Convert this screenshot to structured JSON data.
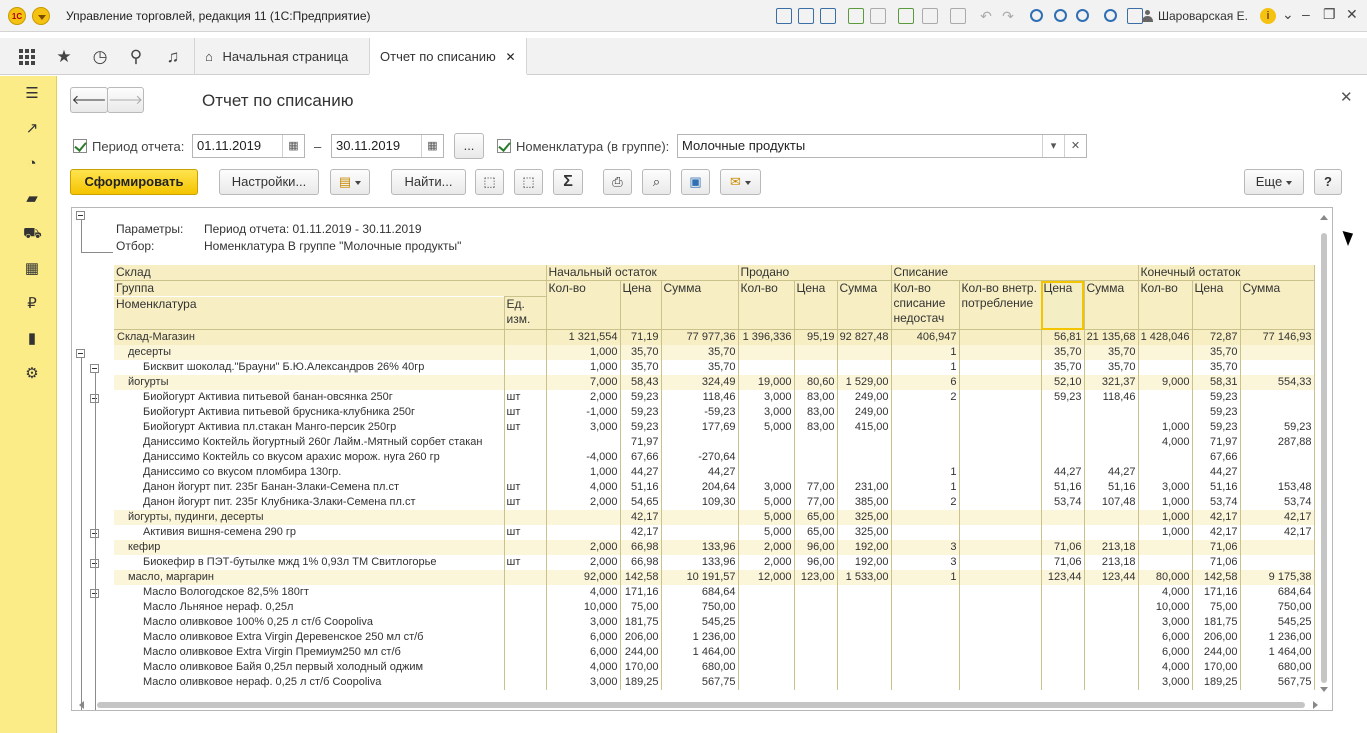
{
  "window": {
    "app_title": "Управление торговлей, редакция 11  (1С:Предприятие)",
    "user": "Шароварская Е.",
    "logo_text": "1С"
  },
  "sections": {
    "tabs": [
      {
        "label": "Начальная страница"
      },
      {
        "label": "Отчет по списанию"
      }
    ]
  },
  "form": {
    "title": "Отчет по списанию",
    "period_label": "Период отчета:",
    "period_from": "01.11.2019",
    "period_dash": "–",
    "period_to": "30.11.2019",
    "more_btn": "...",
    "nomen_label": "Номенклатура (в группе):",
    "nomen_value": "Молочные продукты",
    "generate_btn": "Сформировать",
    "settings_btn": "Настройки...",
    "find_btn": "Найти...",
    "more_menu_btn": "Еще",
    "help_btn": "?",
    "sigma_btn": "Σ"
  },
  "report": {
    "params_label": "Параметры:",
    "params_value": "Период отчета: 01.11.2019 - 30.11.2019",
    "filter_label": "Отбор:",
    "filter_value": "Номенклатура В группе \"Молочные продукты\"",
    "head": {
      "sklad": "Склад",
      "gruppa": "Группа",
      "nomen": "Номенклатура",
      "ed": "Ед. изм.",
      "start": "Начальный остаток",
      "sold": "Продано",
      "writeoff": "Списание",
      "end": "Конечный остаток",
      "qty": "Кол-во",
      "price": "Цена",
      "sum": "Сумма",
      "qty_short": "Кол-во списание недостач",
      "qty_internal": "Кол-во внетр. потребление"
    },
    "rows": [
      {
        "lvl": 0,
        "name": "Склад-Магазин",
        "ed": "",
        "v": [
          "1 321,554",
          "71,19",
          "77 977,36",
          "1 396,336",
          "95,19",
          "92 827,48",
          "406,947",
          "",
          "56,81",
          "21 135,68",
          "1 428,046",
          "72,87",
          "77 146,93"
        ]
      },
      {
        "lvl": 1,
        "name": "десерты",
        "ed": "",
        "v": [
          "1,000",
          "35,70",
          "35,70",
          "",
          "",
          "",
          "1",
          "",
          "35,70",
          "35,70",
          "",
          "35,70",
          ""
        ]
      },
      {
        "lvl": 2,
        "name": "Бисквит шоколад.\"Брауни\" Б.Ю.Александров  26% 40гр",
        "ed": "",
        "v": [
          "1,000",
          "35,70",
          "35,70",
          "",
          "",
          "",
          "1",
          "",
          "35,70",
          "35,70",
          "",
          "35,70",
          ""
        ]
      },
      {
        "lvl": 1,
        "name": "йогурты",
        "ed": "",
        "v": [
          "7,000",
          "58,43",
          "324,49",
          "19,000",
          "80,60",
          "1 529,00",
          "6",
          "",
          "52,10",
          "321,37",
          "9,000",
          "58,31",
          "554,33"
        ]
      },
      {
        "lvl": 2,
        "name": "Биойогурт Активиа питьевой банан-овсянка 250г",
        "ed": "шт",
        "v": [
          "2,000",
          "59,23",
          "118,46",
          "3,000",
          "83,00",
          "249,00",
          "2",
          "",
          "59,23",
          "118,46",
          "",
          "59,23",
          ""
        ]
      },
      {
        "lvl": 2,
        "name": "Биойогурт Активиа питьевой брусника-клубника 250г",
        "ed": "шт",
        "v": [
          "-1,000",
          "59,23",
          "-59,23",
          "3,000",
          "83,00",
          "249,00",
          "",
          "",
          "",
          "",
          "",
          "59,23",
          ""
        ]
      },
      {
        "lvl": 2,
        "name": "Биойогурт Активиа пл.стакан Манго-персик 250гр",
        "ed": "шт",
        "v": [
          "3,000",
          "59,23",
          "177,69",
          "5,000",
          "83,00",
          "415,00",
          "",
          "",
          "",
          "",
          "1,000",
          "59,23",
          "59,23"
        ]
      },
      {
        "lvl": 2,
        "name": "Даниссимо Коктейль йогуртный 260г Лайм.-Мятный сорбет стакан",
        "ed": "",
        "v": [
          "",
          "71,97",
          "",
          "",
          "",
          "",
          "",
          "",
          "",
          "",
          "4,000",
          "71,97",
          "287,88"
        ]
      },
      {
        "lvl": 2,
        "name": "Даниссимо Коктейль со вкусом арахис морож. нуга  260 гр",
        "ed": "",
        "v": [
          "-4,000",
          "67,66",
          "-270,64",
          "",
          "",
          "",
          "",
          "",
          "",
          "",
          "",
          "67,66",
          ""
        ]
      },
      {
        "lvl": 2,
        "name": "Даниссимо со вкусом пломбира 130гр.",
        "ed": "",
        "v": [
          "1,000",
          "44,27",
          "44,27",
          "",
          "",
          "",
          "1",
          "",
          "44,27",
          "44,27",
          "",
          "44,27",
          ""
        ]
      },
      {
        "lvl": 2,
        "name": "Данон йогурт пит. 235г Банан-Злаки-Семена пл.ст",
        "ed": "шт",
        "v": [
          "4,000",
          "51,16",
          "204,64",
          "3,000",
          "77,00",
          "231,00",
          "1",
          "",
          "51,16",
          "51,16",
          "3,000",
          "51,16",
          "153,48"
        ]
      },
      {
        "lvl": 2,
        "name": "Данон йогурт пит. 235г Клубника-Злаки-Семена пл.ст",
        "ed": "шт",
        "v": [
          "2,000",
          "54,65",
          "109,30",
          "5,000",
          "77,00",
          "385,00",
          "2",
          "",
          "53,74",
          "107,48",
          "1,000",
          "53,74",
          "53,74"
        ]
      },
      {
        "lvl": 1,
        "name": "йогурты, пудинги, десерты",
        "ed": "",
        "v": [
          "",
          "42,17",
          "",
          "5,000",
          "65,00",
          "325,00",
          "",
          "",
          "",
          "",
          "1,000",
          "42,17",
          "42,17"
        ]
      },
      {
        "lvl": 2,
        "name": "Активия вишня-семена 290 гр",
        "ed": "шт",
        "v": [
          "",
          "42,17",
          "",
          "5,000",
          "65,00",
          "325,00",
          "",
          "",
          "",
          "",
          "1,000",
          "42,17",
          "42,17"
        ]
      },
      {
        "lvl": 1,
        "name": "кефир",
        "ed": "",
        "v": [
          "2,000",
          "66,98",
          "133,96",
          "2,000",
          "96,00",
          "192,00",
          "3",
          "",
          "71,06",
          "213,18",
          "",
          "71,06",
          ""
        ]
      },
      {
        "lvl": 2,
        "name": "Биокефир в ПЭТ-бутылке мжд 1% 0,93л ТМ Свитлогорье",
        "ed": "шт",
        "v": [
          "2,000",
          "66,98",
          "133,96",
          "2,000",
          "96,00",
          "192,00",
          "3",
          "",
          "71,06",
          "213,18",
          "",
          "71,06",
          ""
        ]
      },
      {
        "lvl": 1,
        "name": "масло, маргарин",
        "ed": "",
        "v": [
          "92,000",
          "142,58",
          "10 191,57",
          "12,000",
          "123,00",
          "1 533,00",
          "1",
          "",
          "123,44",
          "123,44",
          "80,000",
          "142,58",
          "9 175,38"
        ]
      },
      {
        "lvl": 2,
        "name": "Масло Вологодское 82,5% 180гт",
        "ed": "",
        "v": [
          "4,000",
          "171,16",
          "684,64",
          "",
          "",
          "",
          "",
          "",
          "",
          "",
          "4,000",
          "171,16",
          "684,64"
        ]
      },
      {
        "lvl": 2,
        "name": "Масло Льняное нераф. 0,25л",
        "ed": "",
        "v": [
          "10,000",
          "75,00",
          "750,00",
          "",
          "",
          "",
          "",
          "",
          "",
          "",
          "10,000",
          "75,00",
          "750,00"
        ]
      },
      {
        "lvl": 2,
        "name": "Масло оливковое 100% 0,25 л ст/б Coopoliva",
        "ed": "",
        "v": [
          "3,000",
          "181,75",
          "545,25",
          "",
          "",
          "",
          "",
          "",
          "",
          "",
          "3,000",
          "181,75",
          "545,25"
        ]
      },
      {
        "lvl": 2,
        "name": "Масло оливковое Extra Virgin Деревенское 250 мл ст/б",
        "ed": "",
        "v": [
          "6,000",
          "206,00",
          "1 236,00",
          "",
          "",
          "",
          "",
          "",
          "",
          "",
          "6,000",
          "206,00",
          "1 236,00"
        ]
      },
      {
        "lvl": 2,
        "name": "Масло оливковое Extra Virgin Премиум250 мл ст/б",
        "ed": "",
        "v": [
          "6,000",
          "244,00",
          "1 464,00",
          "",
          "",
          "",
          "",
          "",
          "",
          "",
          "6,000",
          "244,00",
          "1 464,00"
        ]
      },
      {
        "lvl": 2,
        "name": "Масло оливковое Байя 0,25л первый холодный оджим",
        "ed": "",
        "v": [
          "4,000",
          "170,00",
          "680,00",
          "",
          "",
          "",
          "",
          "",
          "",
          "",
          "4,000",
          "170,00",
          "680,00"
        ]
      },
      {
        "lvl": 2,
        "name": "Масло оливковое нераф. 0,25 л ст/б Coopoliva",
        "ed": "",
        "v": [
          "3,000",
          "189,25",
          "567,75",
          "",
          "",
          "",
          "",
          "",
          "",
          "",
          "3,000",
          "189,25",
          "567,75"
        ]
      }
    ]
  }
}
